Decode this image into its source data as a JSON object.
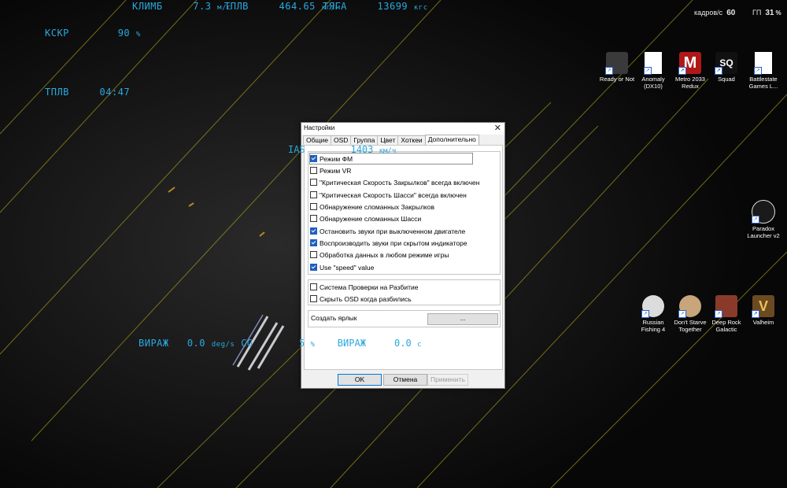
{
  "osd": {
    "climb_label": "КЛИМБ",
    "climb_value": "7.3",
    "climb_unit": "м/с",
    "fuel_label": "ТПЛВ",
    "fuel_value": "464.65",
    "fuel_unit": "кг/м",
    "thrust_label": "ТЯГА",
    "thrust_value": "13699",
    "thrust_unit": "кгс",
    "kskr_label": "КСКР",
    "kskr_value": "90",
    "kskr_unit": "%",
    "tplv_label": "ТПЛВ",
    "tplv_value": "04:47",
    "ias_label": "IAS",
    "ias_value": "1403",
    "ias_unit": "км/ч",
    "turn_label": "ВИРАЖ",
    "turn_value": "0.0",
    "turn_unit": "deg/s",
    "cg_label": "CG",
    "cg_value": "5",
    "cg_unit": "%",
    "turn2_label": "ВИРАЖ",
    "turn2_value": "0.0",
    "turn2_unit": "с"
  },
  "fps_counter": {
    "fps_label": "кадров/с",
    "fps_value": "60",
    "gpu_label": "ГП",
    "gpu_value": "31",
    "gpu_unit": "%"
  },
  "desktop_icons": [
    {
      "label": "Ready or Not",
      "icon": "ready-or-not-icon",
      "color": "#3a3a3a"
    },
    {
      "label": "Anomaly (DX10)",
      "icon": "file-icon",
      "color": "#ffffff"
    },
    {
      "label": "Metro 2033 Redux",
      "icon": "metro-icon",
      "color": "#b01818"
    },
    {
      "label": "Squad",
      "icon": "squad-icon",
      "color": "#111111"
    },
    {
      "label": "Battlestate Games L...",
      "icon": "file-icon",
      "color": "#ffffff"
    },
    {
      "label": "Paradox Launcher v2",
      "icon": "paradox-icon",
      "color": "#1a1a1a"
    },
    {
      "label": "Russian Fishing 4",
      "icon": "fishing-icon",
      "color": "#dcdcdc"
    },
    {
      "label": "Don't Starve Together",
      "icon": "dont-starve-icon",
      "color": "#c8a57a"
    },
    {
      "label": "Deep Rock Galactic",
      "icon": "deep-rock-icon",
      "color": "#8a3a2a"
    },
    {
      "label": "Valheim",
      "icon": "valheim-icon",
      "color": "#6b4a22"
    }
  ],
  "dialog": {
    "title": "Настройки",
    "tabs": [
      "Общие",
      "OSD",
      "Группа",
      "Цвет",
      "Хоткеи",
      "Дополнительно"
    ],
    "active_tab": "Дополнительно",
    "options": [
      {
        "label": "Режим ФМ",
        "checked": true
      },
      {
        "label": "Режим VR",
        "checked": false
      },
      {
        "label": "\"Критическая Скорость Закрылков\" всегда включен",
        "checked": false
      },
      {
        "label": "\"Критическая Скорость Шасси\" всегда включен",
        "checked": false
      },
      {
        "label": "Обнаружение сломанных Закрылков",
        "checked": false
      },
      {
        "label": "Обнаружение сломанных Шасси",
        "checked": false
      },
      {
        "label": "Остановить звуки при выключенном двигателе",
        "checked": true
      },
      {
        "label": "Воспроизводить звуки при скрытом индикаторе",
        "checked": true
      },
      {
        "label": "Обработка данных в любом режиме игры",
        "checked": false
      },
      {
        "label": "Use \"speed\" value",
        "checked": true
      }
    ],
    "options2": [
      {
        "label": "Система Проверки на Разбитие",
        "checked": false
      },
      {
        "label": "Скрыть OSD когда разбились",
        "checked": false
      }
    ],
    "shortcut_label": "Создать ярлык",
    "browse_label": "...",
    "ok_label": "OK",
    "cancel_label": "Отмена",
    "apply_label": "Применить"
  }
}
